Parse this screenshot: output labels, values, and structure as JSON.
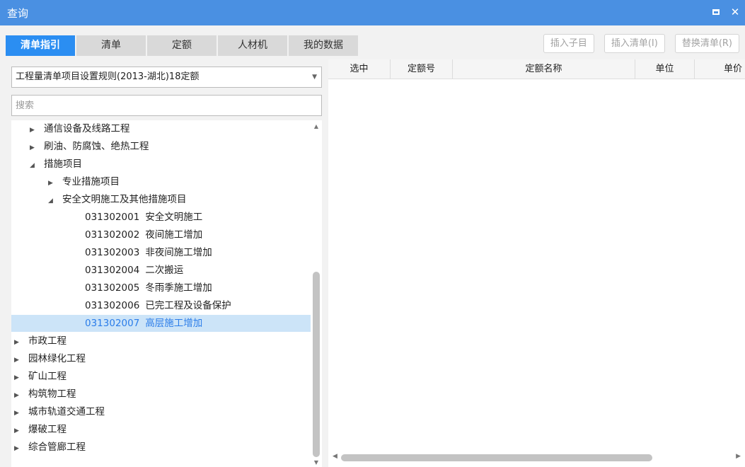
{
  "window": {
    "title": "查询"
  },
  "tabs": [
    {
      "label": "清单指引",
      "active": true
    },
    {
      "label": "清单",
      "active": false
    },
    {
      "label": "定额",
      "active": false
    },
    {
      "label": "人材机",
      "active": false
    },
    {
      "label": "我的数据",
      "active": false
    }
  ],
  "actions": {
    "insert_child": "插入子目",
    "insert_list": "插入清单(I)",
    "replace_list": "替换清单(R)"
  },
  "ruleset": {
    "selected": "工程量清单项目设置规则(2013-湖北)18定额"
  },
  "search": {
    "placeholder": "搜索"
  },
  "tree": [
    {
      "label": "通信设备及线路工程",
      "code": "",
      "state": "collapsed"
    },
    {
      "label": "刷油、防腐蚀、绝热工程",
      "code": "",
      "state": "collapsed"
    },
    {
      "label": "措施项目",
      "code": "",
      "state": "expanded"
    },
    {
      "label": "专业措施项目",
      "code": "",
      "state": "collapsed"
    },
    {
      "label": "安全文明施工及其他措施项目",
      "code": "",
      "state": "expanded"
    },
    {
      "label": "安全文明施工",
      "code": "031302001",
      "state": "leaf"
    },
    {
      "label": "夜间施工增加",
      "code": "031302002",
      "state": "leaf"
    },
    {
      "label": "非夜间施工增加",
      "code": "031302003",
      "state": "leaf"
    },
    {
      "label": "二次搬运",
      "code": "031302004",
      "state": "leaf"
    },
    {
      "label": "冬雨季施工增加",
      "code": "031302005",
      "state": "leaf"
    },
    {
      "label": "已完工程及设备保护",
      "code": "031302006",
      "state": "leaf"
    },
    {
      "label": "高层施工增加",
      "code": "031302007",
      "state": "leaf",
      "selected": true
    },
    {
      "label": "市政工程",
      "code": "",
      "state": "collapsed"
    },
    {
      "label": "园林绿化工程",
      "code": "",
      "state": "collapsed"
    },
    {
      "label": "矿山工程",
      "code": "",
      "state": "collapsed"
    },
    {
      "label": "构筑物工程",
      "code": "",
      "state": "collapsed"
    },
    {
      "label": "城市轨道交通工程",
      "code": "",
      "state": "collapsed"
    },
    {
      "label": "爆破工程",
      "code": "",
      "state": "collapsed"
    },
    {
      "label": "综合管廊工程",
      "code": "",
      "state": "collapsed"
    }
  ],
  "table": {
    "columns": [
      "选中",
      "定额号",
      "定额名称",
      "单位",
      "单价"
    ]
  },
  "colors": {
    "titlebar": "#4a90e2",
    "active_tab": "#2b8ef2",
    "selected_row": "#cce4f8"
  }
}
